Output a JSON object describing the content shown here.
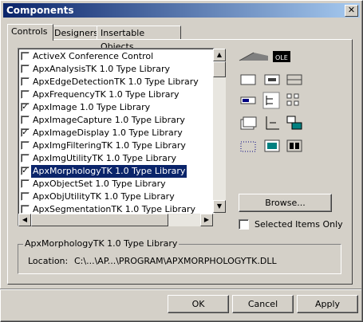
{
  "window": {
    "title": "Components",
    "close_glyph": "✕"
  },
  "tabs": [
    {
      "label": "Controls"
    },
    {
      "label": "Designers"
    },
    {
      "label": "Insertable Objects"
    }
  ],
  "list": {
    "items": [
      {
        "label": "ActiveX Conference Control",
        "checked": false
      },
      {
        "label": "ApxAnalysisTK 1.0 Type Library",
        "checked": false
      },
      {
        "label": "ApxEdgeDetectionTK 1.0 Type Library",
        "checked": false
      },
      {
        "label": "ApxFrequencyTK 1.0 Type Library",
        "checked": false
      },
      {
        "label": "ApxImage 1.0 Type Library",
        "checked": true
      },
      {
        "label": "ApxImageCapture 1.0 Type Library",
        "checked": false
      },
      {
        "label": "ApxImageDisplay 1.0 Type Library",
        "checked": true
      },
      {
        "label": "ApxImgFilteringTK 1.0 Type Library",
        "checked": false
      },
      {
        "label": "ApxImgUtilityTK 1.0 Type Library",
        "checked": false
      },
      {
        "label": "ApxMorphologyTK 1.0 Type Library",
        "checked": true,
        "selected": true
      },
      {
        "label": "ApxObjectSet 1.0 Type Library",
        "checked": false
      },
      {
        "label": "ApxObjUtilityTK 1.0 Type Library",
        "checked": false
      },
      {
        "label": "ApxSegmentationTK 1.0 Type Library",
        "checked": false
      }
    ],
    "check_glyph": "✓"
  },
  "icon_names": [
    "ruler-toolbar-icon",
    "ole-icon",
    "panel-icon",
    "label-panel-icon",
    "status-bar-icon",
    "progress-icon",
    "tree-icon",
    "listview-icon",
    "tabs-icon",
    "axis-icon",
    "network-icon",
    "dotgrid-icon",
    "image-view-icon",
    "display-icon"
  ],
  "browse_label": "Browse...",
  "selected_only_label": "Selected Items Only",
  "details": {
    "title": "ApxMorphologyTK 1.0 Type Library",
    "location_label": "Location:",
    "location_value": "C:\\...\\AP...\\PROGRAM\\APXMORPHOLOGYTK.DLL"
  },
  "buttons": {
    "ok": "OK",
    "cancel": "Cancel",
    "apply": "Apply"
  },
  "colors": {
    "title_start": "#0a246a",
    "title_end": "#a6caf0",
    "selection": "#0a246a",
    "face": "#d4d0c8"
  }
}
